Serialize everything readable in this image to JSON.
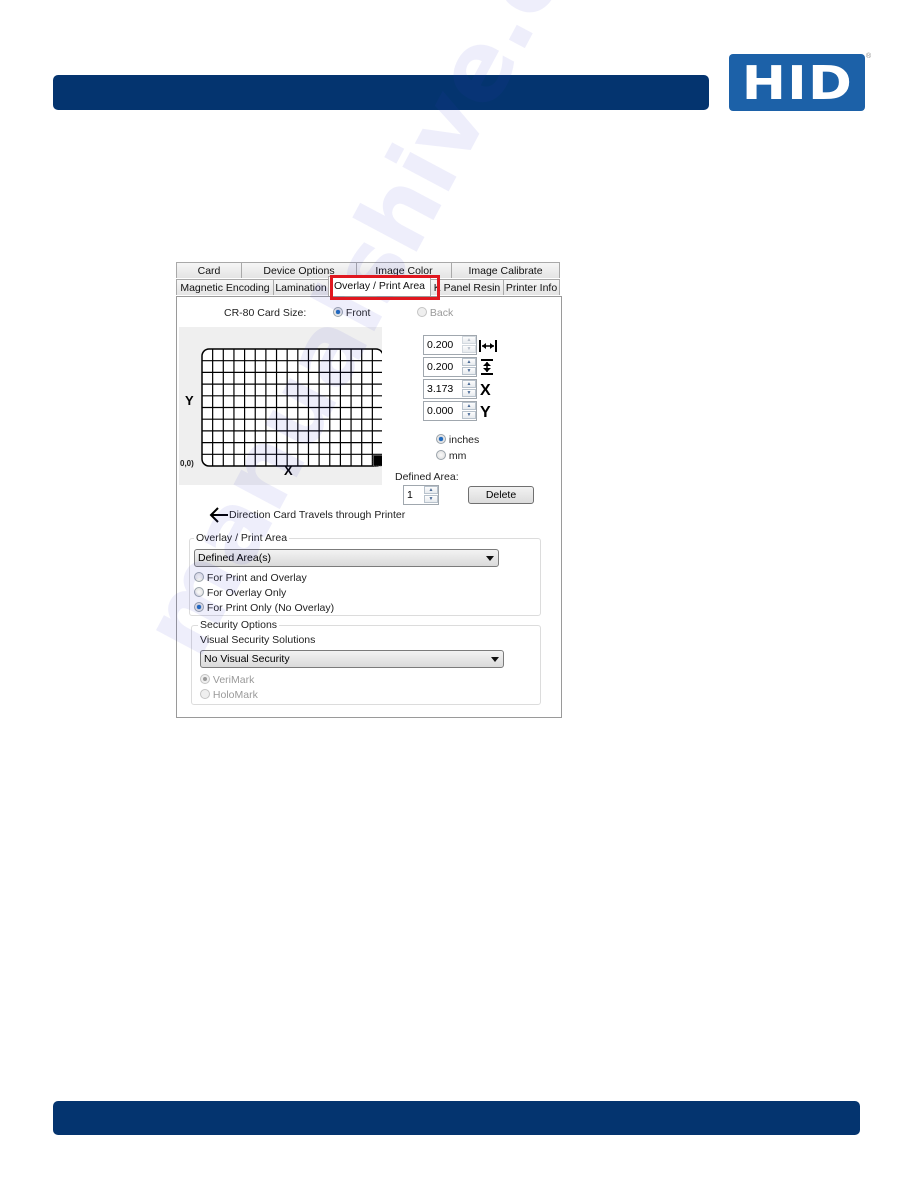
{
  "brand": {
    "logo_text": "HID",
    "registered_mark": "®",
    "colors": {
      "bar": "#04346f",
      "logo": "#1c61a8",
      "highlight": "#e0171f"
    }
  },
  "dialog": {
    "tabs_row1": [
      {
        "label": "Card"
      },
      {
        "label": "Device Options"
      },
      {
        "label": "Image Color"
      },
      {
        "label": "Image Calibrate"
      }
    ],
    "tabs_row2": [
      {
        "label": "Magnetic Encoding"
      },
      {
        "label": "Lamination"
      },
      {
        "label": "Overlay / Print Area",
        "active": true
      },
      {
        "label": "K Panel Resin"
      },
      {
        "label": "Printer Info"
      }
    ],
    "card_size_label": "CR-80 Card Size:",
    "side": {
      "front_label": "Front",
      "back_label": "Back",
      "selected": "Front"
    },
    "preview": {
      "y_label": "Y",
      "x_label": "X",
      "origin_label": "0,0)",
      "grid_columns": 17,
      "grid_rows": 10
    },
    "fields": [
      {
        "name": "width",
        "value": "0.200",
        "icon": "width-arrows-icon",
        "enabled": false
      },
      {
        "name": "height",
        "value": "0.200",
        "icon": "height-arrows-icon",
        "enabled": true
      },
      {
        "name": "x",
        "value": "3.173",
        "icon": "X",
        "enabled": true
      },
      {
        "name": "y",
        "value": "0.000",
        "icon": "Y",
        "enabled": true
      }
    ],
    "units": {
      "inches_label": "inches",
      "mm_label": "mm",
      "selected": "inches"
    },
    "defined_area": {
      "label": "Defined Area:",
      "value": "1",
      "delete_label": "Delete"
    },
    "direction_label": "Direction Card Travels through Printer",
    "overlay_group": {
      "title": "Overlay / Print Area",
      "dropdown_value": "Defined Area(s)",
      "options": [
        {
          "label": "For Print and Overlay",
          "checked": false
        },
        {
          "label": "For Overlay Only",
          "checked": false
        },
        {
          "label": "For Print Only (No Overlay)",
          "checked": true
        }
      ]
    },
    "security_group": {
      "title": "Security Options",
      "subtitle": "Visual Security Solutions",
      "dropdown_value": "No Visual Security",
      "options": [
        {
          "label": "VeriMark",
          "checked": true,
          "enabled": false
        },
        {
          "label": "HoloMark",
          "checked": false,
          "enabled": false
        }
      ]
    }
  },
  "watermark": "manualshive.com"
}
